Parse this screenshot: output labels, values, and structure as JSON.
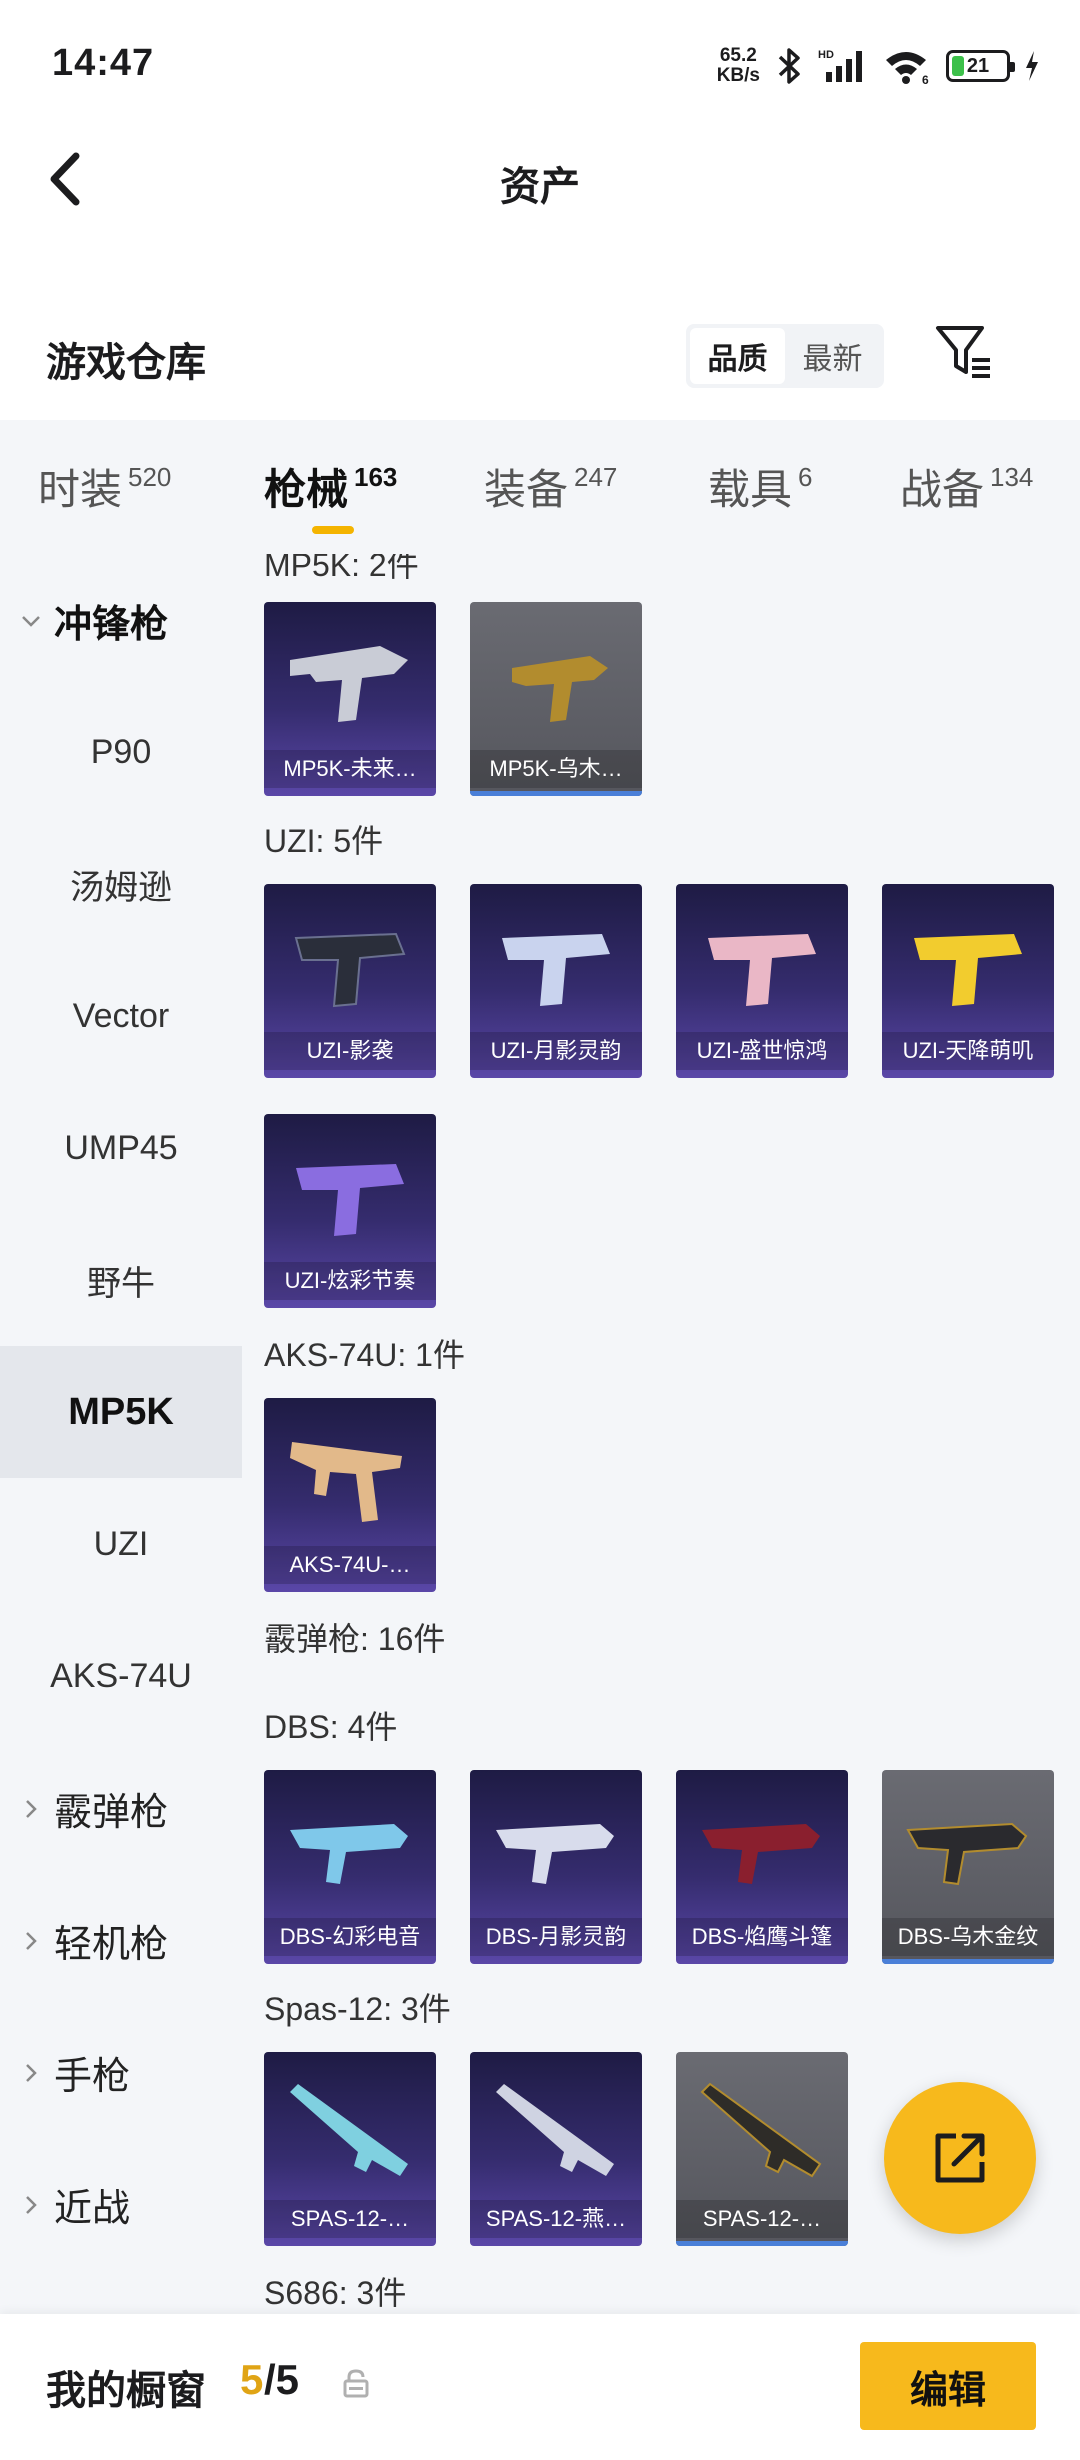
{
  "status": {
    "time": "14:47",
    "net_speed_value": "65.2",
    "net_speed_unit": "KB/s",
    "hd": "HD",
    "wifi_label": "6",
    "battery": "21"
  },
  "nav": {
    "title": "资产"
  },
  "warehouse": {
    "title": "游戏仓库",
    "sort_quality": "品质",
    "sort_latest": "最新"
  },
  "tabs": [
    {
      "label": "时装",
      "count": "520"
    },
    {
      "label": "枪械",
      "count": "163"
    },
    {
      "label": "装备",
      "count": "247"
    },
    {
      "label": "载具",
      "count": "6"
    },
    {
      "label": "战备",
      "count": "134"
    }
  ],
  "sidebar": [
    {
      "label": "冲锋枪"
    },
    {
      "label": "P90"
    },
    {
      "label": "汤姆逊"
    },
    {
      "label": "Vector"
    },
    {
      "label": "UMP45"
    },
    {
      "label": "野牛"
    },
    {
      "label": "MP5K"
    },
    {
      "label": "UZI"
    },
    {
      "label": "AKS-74U"
    },
    {
      "label": "霰弹枪"
    },
    {
      "label": "轻机枪"
    },
    {
      "label": "手枪"
    },
    {
      "label": "近战"
    }
  ],
  "groups": {
    "mp5k": {
      "title": "MP5K: 2件",
      "items": [
        "MP5K-未来…",
        "MP5K-乌木…"
      ]
    },
    "uzi": {
      "title": "UZI: 5件",
      "items": [
        "UZI-影袭",
        "UZI-月影灵韵",
        "UZI-盛世惊鸿",
        "UZI-天降萌叽",
        "UZI-炫彩节奏"
      ]
    },
    "aks": {
      "title": "AKS-74U: 1件",
      "items": [
        "AKS-74U-…"
      ]
    },
    "shotgun": {
      "title": "霰弹枪: 16件"
    },
    "dbs": {
      "title": "DBS: 4件",
      "items": [
        "DBS-幻彩电音",
        "DBS-月影灵韵",
        "DBS-焰鹰斗篷",
        "DBS-乌木金纹"
      ]
    },
    "spas": {
      "title": "Spas-12: 3件",
      "items": [
        "SPAS-12-…",
        "SPAS-12-燕…",
        "SPAS-12-…"
      ]
    },
    "s686": {
      "title": "S686: 3件"
    }
  },
  "bottom": {
    "title": "我的橱窗",
    "count_current": "5",
    "count_rest": "/5",
    "edit": "编辑"
  },
  "colors": {
    "accent": "#f7b91c",
    "card_purple": "#352c6e",
    "card_gray": "#5e5f66"
  }
}
